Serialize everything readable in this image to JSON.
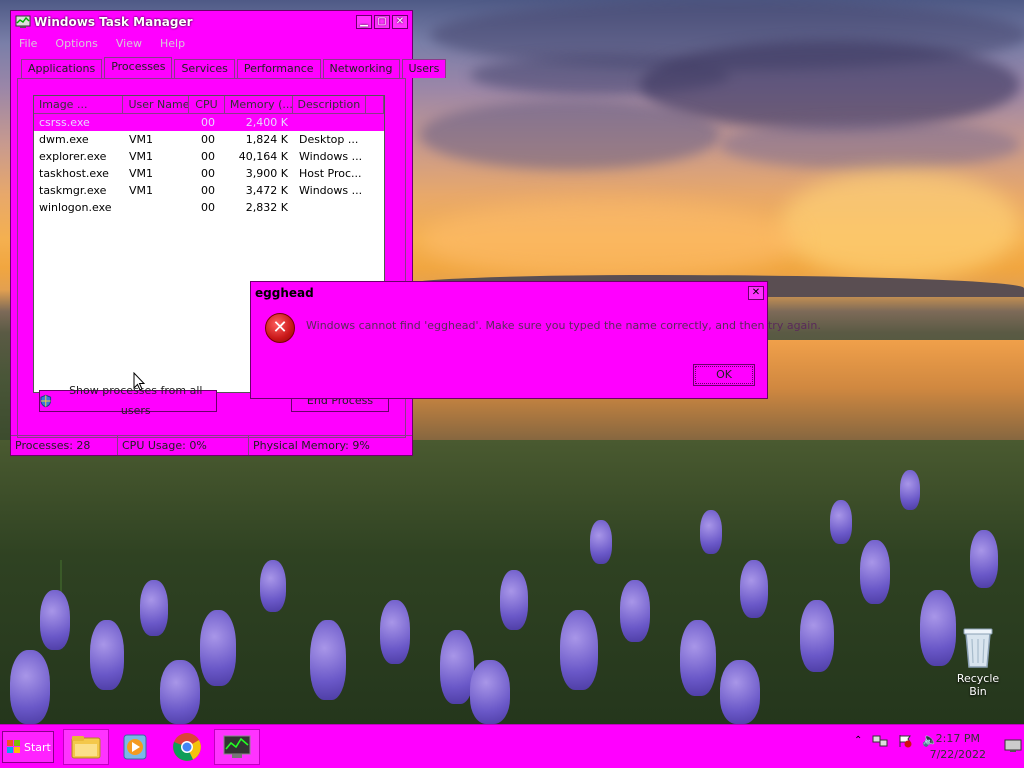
{
  "taskmgr": {
    "title": "Windows Task Manager",
    "menu": [
      "File",
      "Options",
      "View",
      "Help"
    ],
    "tabs": [
      "Applications",
      "Processes",
      "Services",
      "Performance",
      "Networking",
      "Users"
    ],
    "active_tab": "Processes",
    "columns": [
      "Image ...",
      "User Name",
      "CPU",
      "Memory (...",
      "Description"
    ],
    "rows": [
      {
        "image": "csrss.exe",
        "user": "",
        "cpu": "00",
        "memory": "2,400 K",
        "description": ""
      },
      {
        "image": "dwm.exe",
        "user": "VM1",
        "cpu": "00",
        "memory": "1,824 K",
        "description": "Desktop ..."
      },
      {
        "image": "explorer.exe",
        "user": "VM1",
        "cpu": "00",
        "memory": "40,164 K",
        "description": "Windows ..."
      },
      {
        "image": "taskhost.exe",
        "user": "VM1",
        "cpu": "00",
        "memory": "3,900 K",
        "description": "Host Proc..."
      },
      {
        "image": "taskmgr.exe",
        "user": "VM1",
        "cpu": "00",
        "memory": "3,472 K",
        "description": "Windows ..."
      },
      {
        "image": "winlogon.exe",
        "user": "",
        "cpu": "00",
        "memory": "2,832 K",
        "description": ""
      }
    ],
    "show_all_label": "Show processes from all users",
    "end_process_label": "End Process",
    "status": {
      "processes": "Processes: 28",
      "cpu": "CPU Usage: 0%",
      "memory": "Physical Memory: 9%"
    }
  },
  "dialog": {
    "title": "egghead",
    "message": "Windows cannot find 'egghead'. Make sure you typed the name correctly, and then try again.",
    "ok_label": "OK"
  },
  "desktop": {
    "recycle_bin": "Recycle Bin"
  },
  "taskbar": {
    "start_label": "Start",
    "time": "2:17 PM",
    "date": "7/22/2022"
  }
}
